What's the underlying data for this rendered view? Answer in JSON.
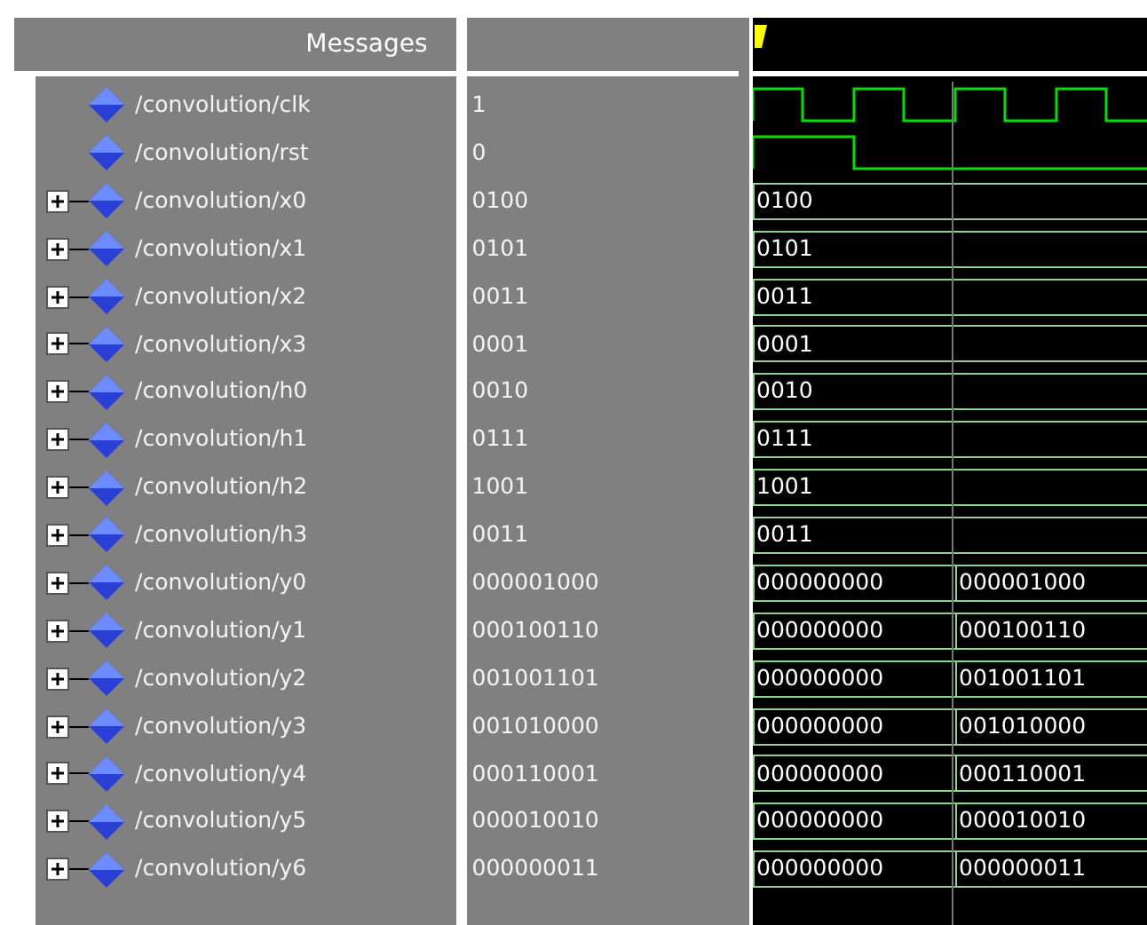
{
  "header": {
    "title": "Messages"
  },
  "signals": [
    {
      "name": "/convolution/clk",
      "value": "1",
      "expandable": false,
      "kind": "clock"
    },
    {
      "name": "/convolution/rst",
      "value": "0",
      "expandable": false,
      "kind": "reset"
    },
    {
      "name": "/convolution/x0",
      "value": "0100",
      "expandable": true,
      "kind": "bus",
      "segments": [
        "0100"
      ]
    },
    {
      "name": "/convolution/x1",
      "value": "0101",
      "expandable": true,
      "kind": "bus",
      "segments": [
        "0101"
      ]
    },
    {
      "name": "/convolution/x2",
      "value": "0011",
      "expandable": true,
      "kind": "bus",
      "segments": [
        "0011"
      ]
    },
    {
      "name": "/convolution/x3",
      "value": "0001",
      "expandable": true,
      "kind": "bus",
      "segments": [
        "0001"
      ]
    },
    {
      "name": "/convolution/h0",
      "value": "0010",
      "expandable": true,
      "kind": "bus",
      "segments": [
        "0010"
      ]
    },
    {
      "name": "/convolution/h1",
      "value": "0111",
      "expandable": true,
      "kind": "bus",
      "segments": [
        "0111"
      ]
    },
    {
      "name": "/convolution/h2",
      "value": "1001",
      "expandable": true,
      "kind": "bus",
      "segments": [
        "1001"
      ]
    },
    {
      "name": "/convolution/h3",
      "value": "0011",
      "expandable": true,
      "kind": "bus",
      "segments": [
        "0011"
      ]
    },
    {
      "name": "/convolution/y0",
      "value": "000001000",
      "expandable": true,
      "kind": "bus",
      "segments": [
        "000000000",
        "000001000"
      ]
    },
    {
      "name": "/convolution/y1",
      "value": "000100110",
      "expandable": true,
      "kind": "bus",
      "segments": [
        "000000000",
        "000100110"
      ]
    },
    {
      "name": "/convolution/y2",
      "value": "001001101",
      "expandable": true,
      "kind": "bus",
      "segments": [
        "000000000",
        "001001101"
      ]
    },
    {
      "name": "/convolution/y3",
      "value": "001010000",
      "expandable": true,
      "kind": "bus",
      "segments": [
        "000000000",
        "001010000"
      ]
    },
    {
      "name": "/convolution/y4",
      "value": "000110001",
      "expandable": true,
      "kind": "bus",
      "segments": [
        "000000000",
        "000110001"
      ]
    },
    {
      "name": "/convolution/y5",
      "value": "000010010",
      "expandable": true,
      "kind": "bus",
      "segments": [
        "000000000",
        "000010010"
      ]
    },
    {
      "name": "/convolution/y6",
      "value": "000000011",
      "expandable": true,
      "kind": "bus",
      "segments": [
        "000000000",
        "000000011"
      ]
    }
  ]
}
